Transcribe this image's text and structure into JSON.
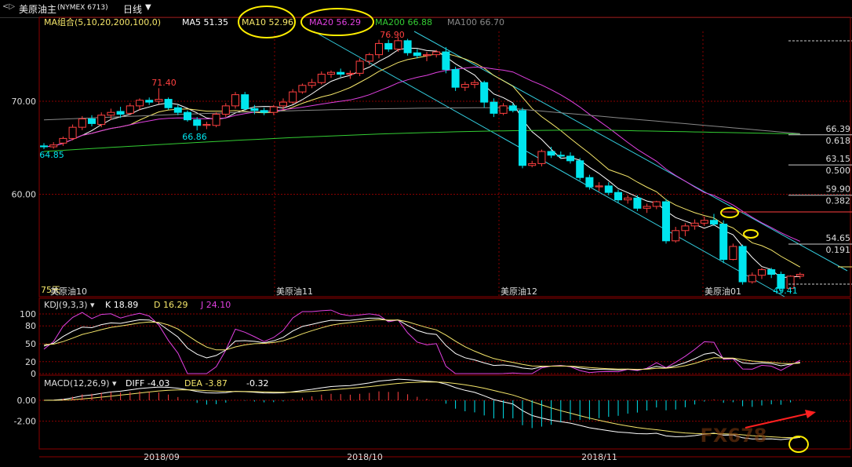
{
  "titlebar": {
    "icon_name": "collapse-chevron-icon",
    "instrument": "美原油主",
    "code": "(NYMEX 6713)",
    "period": "日线",
    "dropdown_icon": "chevron-down-icon"
  },
  "main_panel": {
    "ma_group_label": "MA组合(5,10,20,200,100,0)",
    "legend": [
      {
        "label": "MA5 51.35",
        "color": "#ffffff"
      },
      {
        "label": "MA10 52.96",
        "color": "#f5e66a"
      },
      {
        "label": "MA20 56.29",
        "color": "#e040e0"
      },
      {
        "label": "MA200 66.88",
        "color": "#33cc33"
      },
      {
        "label": "MA100 66.70",
        "color": "#888888"
      }
    ],
    "price_axis_labels": [
      "70.00",
      "60.00"
    ],
    "corner_label": "75天",
    "contract_labels": [
      "美原油10",
      "美原油11",
      "美原油12",
      "美原油01"
    ],
    "price_annotations": [
      "76.90",
      "71.40",
      "66.86",
      "64.85",
      "49.41"
    ],
    "fib_levels": [
      {
        "price": "66.39",
        "ratio": "0.618"
      },
      {
        "price": "63.15",
        "ratio": "0.500"
      },
      {
        "price": "59.90",
        "ratio": "0.382"
      },
      {
        "price": "54.65",
        "ratio": "0.191"
      }
    ]
  },
  "kdj_panel": {
    "label": "KDJ(9,3,3)",
    "values": [
      {
        "label": "K 18.89",
        "color": "#ffffff"
      },
      {
        "label": "D 16.29",
        "color": "#f5e66a"
      },
      {
        "label": "J 24.10",
        "color": "#e040e0"
      }
    ],
    "axis_labels": [
      "100",
      "80",
      "50",
      "20",
      "0"
    ]
  },
  "macd_panel": {
    "label": "MACD(12,26,9)",
    "values": [
      {
        "label": "DIFF -4.03",
        "color": "#ffffff"
      },
      {
        "label": "DEA -3.87",
        "color": "#f5e66a"
      },
      {
        "label": "-0.32",
        "color": "#ffffff"
      }
    ],
    "axis_labels": [
      "0.00",
      "-2.00"
    ]
  },
  "date_axis": [
    "2018/09",
    "2018/10",
    "2018/11"
  ],
  "watermark": "FX678",
  "colors": {
    "up": "#ff4040",
    "down": "#00e5ee",
    "grid": "#8b0000",
    "channel": "#33ccdd",
    "highlight": "#ffee00",
    "arrow": "#ff2020"
  },
  "chart_data": {
    "type": "candlestick",
    "title": "美原油主 (NYMEX 6713) 日线",
    "ylim": [
      49,
      77.5
    ],
    "candles": [
      [
        65.2,
        65.5,
        64.85,
        65.1
      ],
      [
        65.1,
        65.6,
        64.9,
        65.3
      ],
      [
        65.5,
        66.2,
        65.2,
        66.0
      ],
      [
        66.0,
        67.5,
        65.8,
        67.2
      ],
      [
        67.2,
        68.4,
        66.9,
        68.1
      ],
      [
        68.1,
        68.5,
        67.3,
        67.6
      ],
      [
        67.5,
        68.8,
        67.2,
        68.5
      ],
      [
        68.5,
        69.2,
        68.0,
        68.8
      ],
      [
        68.9,
        69.4,
        68.2,
        68.6
      ],
      [
        68.7,
        69.8,
        68.5,
        69.5
      ],
      [
        69.5,
        70.3,
        69.0,
        70.1
      ],
      [
        70.1,
        70.4,
        69.6,
        69.9
      ],
      [
        70.0,
        71.4,
        69.7,
        70.2
      ],
      [
        70.2,
        70.4,
        69.1,
        69.3
      ],
      [
        69.3,
        69.6,
        68.5,
        68.8
      ],
      [
        68.8,
        69.0,
        67.8,
        68.0
      ],
      [
        68.0,
        68.3,
        66.86,
        67.4
      ],
      [
        67.4,
        67.8,
        67.0,
        67.5
      ],
      [
        67.4,
        68.8,
        67.2,
        68.6
      ],
      [
        68.6,
        69.8,
        68.3,
        69.5
      ],
      [
        69.5,
        71.0,
        69.2,
        70.7
      ],
      [
        70.7,
        71.0,
        69.0,
        69.2
      ],
      [
        69.2,
        69.6,
        68.6,
        69.0
      ],
      [
        69.0,
        69.3,
        68.5,
        68.8
      ],
      [
        68.8,
        69.6,
        68.5,
        69.4
      ],
      [
        69.5,
        70.3,
        69.1,
        69.9
      ],
      [
        69.9,
        71.3,
        69.7,
        71.0
      ],
      [
        71.0,
        71.9,
        70.8,
        71.7
      ],
      [
        71.7,
        72.4,
        71.4,
        72.0
      ],
      [
        72.0,
        73.2,
        71.8,
        72.9
      ],
      [
        72.9,
        73.3,
        72.5,
        73.1
      ],
      [
        73.1,
        73.5,
        72.6,
        72.9
      ],
      [
        72.9,
        73.3,
        72.4,
        73.0
      ],
      [
        73.0,
        74.6,
        72.7,
        74.3
      ],
      [
        74.3,
        75.2,
        73.9,
        75.0
      ],
      [
        75.0,
        76.6,
        74.6,
        76.2
      ],
      [
        76.2,
        76.6,
        75.3,
        75.6
      ],
      [
        75.6,
        76.9,
        75.3,
        76.5
      ],
      [
        76.5,
        76.7,
        74.9,
        75.2
      ],
      [
        75.2,
        75.6,
        74.6,
        74.9
      ],
      [
        74.9,
        75.3,
        74.3,
        75.0
      ],
      [
        75.0,
        75.5,
        74.7,
        75.3
      ],
      [
        75.3,
        75.8,
        73.0,
        73.4
      ],
      [
        73.4,
        73.7,
        71.1,
        71.5
      ],
      [
        71.5,
        72.1,
        71.1,
        71.8
      ],
      [
        71.8,
        72.3,
        71.4,
        72.0
      ],
      [
        72.0,
        72.2,
        69.3,
        69.9
      ],
      [
        69.9,
        70.3,
        68.3,
        68.7
      ],
      [
        68.7,
        69.8,
        68.5,
        69.5
      ],
      [
        69.5,
        69.8,
        68.8,
        69.0
      ],
      [
        69.0,
        69.3,
        62.8,
        63.1
      ],
      [
        63.1,
        63.6,
        62.9,
        63.3
      ],
      [
        63.3,
        64.8,
        63.0,
        64.6
      ],
      [
        64.6,
        65.1,
        63.9,
        64.2
      ],
      [
        64.2,
        64.6,
        63.8,
        64.1
      ],
      [
        64.1,
        64.5,
        63.3,
        63.6
      ],
      [
        63.6,
        63.9,
        61.5,
        61.8
      ],
      [
        61.8,
        62.1,
        60.5,
        60.8
      ],
      [
        60.8,
        61.3,
        60.3,
        60.9
      ],
      [
        60.9,
        61.3,
        59.9,
        60.2
      ],
      [
        60.2,
        60.5,
        59.1,
        59.4
      ],
      [
        59.4,
        59.9,
        59.0,
        59.6
      ],
      [
        59.6,
        59.9,
        58.2,
        58.5
      ],
      [
        58.5,
        59.0,
        58.0,
        58.7
      ],
      [
        58.7,
        59.3,
        58.4,
        59.2
      ],
      [
        59.2,
        59.5,
        54.7,
        55.0
      ],
      [
        55.0,
        56.5,
        54.8,
        56.1
      ],
      [
        56.1,
        56.9,
        55.5,
        56.6
      ],
      [
        56.6,
        57.3,
        56.2,
        56.9
      ],
      [
        56.9,
        57.6,
        56.6,
        57.2
      ],
      [
        57.2,
        57.9,
        56.6,
        56.8
      ],
      [
        56.8,
        57.2,
        52.6,
        53.0
      ],
      [
        53.0,
        54.7,
        52.9,
        54.4
      ],
      [
        54.4,
        54.6,
        50.3,
        50.6
      ],
      [
        50.6,
        51.6,
        50.4,
        51.3
      ],
      [
        51.3,
        52.1,
        50.9,
        51.9
      ],
      [
        51.9,
        52.1,
        51.0,
        51.4
      ],
      [
        51.4,
        51.7,
        49.41,
        49.9
      ],
      [
        49.9,
        51.3,
        49.6,
        51.2
      ],
      [
        51.2,
        51.6,
        50.9,
        51.4
      ]
    ],
    "moving_averages": {
      "MA5": 51.35,
      "MA10": 52.96,
      "MA20": 56.29,
      "MA200": 66.88,
      "MA100": 66.7
    },
    "kdj": {
      "K": 18.89,
      "D": 16.29,
      "J": 24.1
    },
    "macd": {
      "DIFF": -4.03,
      "DEA": -3.87,
      "MACD": -0.32
    },
    "kdj_ylim": [
      0,
      100
    ],
    "macd_ylim": [
      -4.5,
      1.5
    ]
  }
}
